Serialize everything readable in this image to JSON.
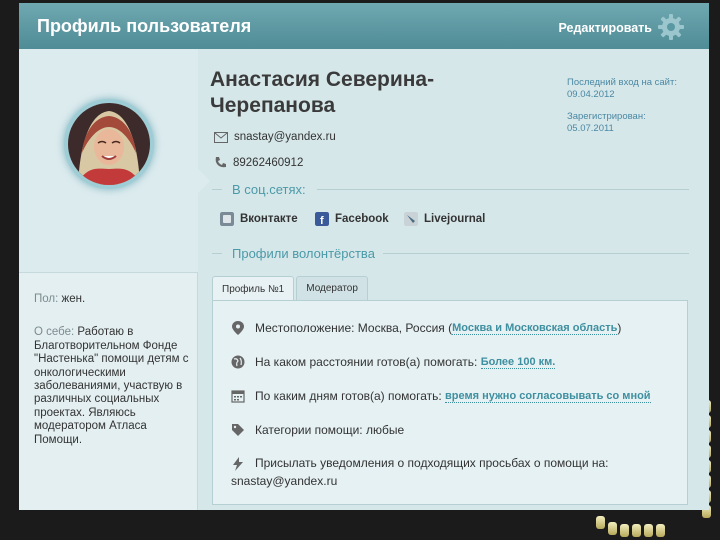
{
  "header": {
    "title": "Профиль пользователя",
    "edit_label": "Редактировать"
  },
  "profile": {
    "name": "Анастасия Северина-Черепанова",
    "email": "snastay@yandex.ru",
    "phone": "89262460912",
    "last_login_label": "Последний вход на сайт:",
    "last_login": "09.04.2012",
    "registered_label": "Зарегистрирован:",
    "registered": "05.07.2011"
  },
  "sidebar": {
    "gender_label": "Пол:",
    "gender": "жен.",
    "about_label": "О себе:",
    "about": "Работаю в Благотворительном Фонде \"Настенька\" помощи детям с онкологическими заболеваниями, участвую в различных социальных проектах. Являюсь модератором Атласа Помощи."
  },
  "social": {
    "heading": "В соц.сетях:",
    "items": [
      {
        "label": "Вконтакте",
        "icon": "vkontakte-icon"
      },
      {
        "label": "Facebook",
        "icon": "facebook-icon"
      },
      {
        "label": "Livejournal",
        "icon": "livejournal-icon"
      }
    ]
  },
  "volunteer": {
    "heading": "Профили волонтёрства",
    "tabs": [
      {
        "label": "Профиль №1",
        "active": true
      },
      {
        "label": "Модератор",
        "active": false
      }
    ],
    "location_label": "Местоположение: Москва, Россия",
    "location_open": "(",
    "location_link": "Москва и Московская область",
    "location_close": ")",
    "distance_label": "На каком расстоянии готов(а) помогать:",
    "distance_value": "Более 100 км.",
    "days_label": "По каким дням готов(а) помогать:",
    "days_value": "время нужно согласовывать со мной",
    "categories_label": "Категории помощи:",
    "categories_value": "любые",
    "notify_label": "Присылать уведомления о подходящих просьбах о помощи на:",
    "notify_email": "snastay@yandex.ru"
  },
  "colors": {
    "header": "#5a98a2",
    "accent": "#4b9aa8",
    "background": "#d6e7ea"
  }
}
